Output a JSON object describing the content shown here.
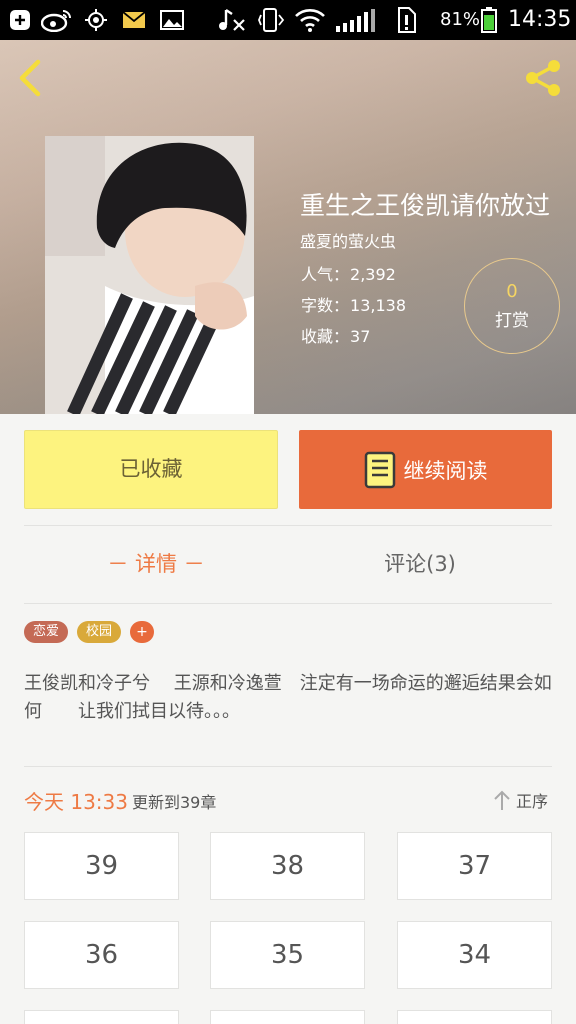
{
  "status_bar": {
    "battery": "81%",
    "time": "14:35",
    "icons": [
      "add-icon",
      "weibo-icon",
      "location-icon",
      "mail-icon",
      "image-icon",
      "music-off-icon",
      "vibrate-icon",
      "wifi-icon",
      "signal-icon",
      "sim-alert-icon",
      "battery-icon"
    ]
  },
  "header": {
    "back_icon": "chevron-left-icon",
    "share_icon": "share-icon",
    "title": "重生之王俊凯请你放过",
    "author": "盛夏的萤火虫",
    "popularity_label": "人气：",
    "popularity": "2,392",
    "words_label": "字数：",
    "words": "13,138",
    "favorites_label": "收藏：",
    "favorites": "37",
    "tip_count": "0",
    "tip_label": "打赏"
  },
  "actions": {
    "favorited_label": "已收藏",
    "continue_label": "继续阅读"
  },
  "tabs": {
    "detail": "－ 详情 －",
    "comments": "评论(3)"
  },
  "tags": [
    "恋爱",
    "校园",
    "+"
  ],
  "description": "王俊凯和冷子兮　 王源和冷逸萱　注定有一场命运的邂逅结果会如何　　让我们拭目以待。。。",
  "update": {
    "date": "今天 13:33",
    "text": "更新到39章",
    "sort_label": "正序"
  },
  "chapters": [
    "39",
    "38",
    "37",
    "36",
    "35",
    "34"
  ],
  "colors": {
    "accent": "#e86a3b",
    "favorite_button": "#fdf37f",
    "tag_romance": "#c46a55",
    "tag_campus": "#d9a93a",
    "tip_count": "#f5d563"
  }
}
